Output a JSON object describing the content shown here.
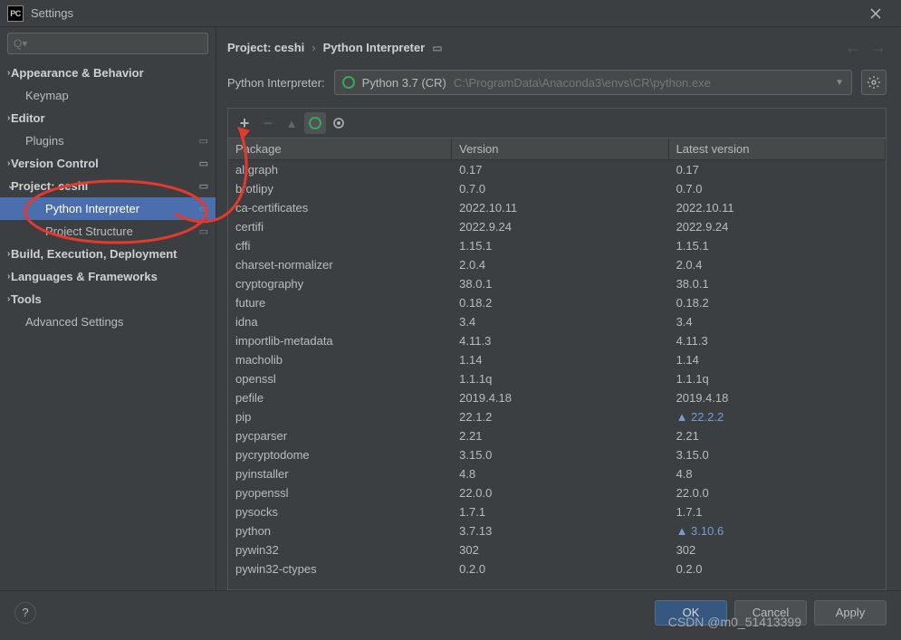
{
  "window": {
    "title": "Settings"
  },
  "search": {
    "placeholder": "Q▾"
  },
  "sidebar": {
    "items": [
      {
        "label": "Appearance & Behavior",
        "expandable": true
      },
      {
        "label": "Keymap"
      },
      {
        "label": "Editor",
        "expandable": true
      },
      {
        "label": "Plugins",
        "marker": "▭"
      },
      {
        "label": "Version Control",
        "expandable": true,
        "marker": "▭"
      },
      {
        "label": "Project: ceshi",
        "expandable": true,
        "expanded": true,
        "marker": "▭"
      },
      {
        "label": "Python Interpreter",
        "depth": 2,
        "selected": true,
        "marker": "▭"
      },
      {
        "label": "Project Structure",
        "depth": 2,
        "marker": "▭"
      },
      {
        "label": "Build, Execution, Deployment",
        "expandable": true
      },
      {
        "label": "Languages & Frameworks",
        "expandable": true
      },
      {
        "label": "Tools",
        "expandable": true
      },
      {
        "label": "Advanced Settings"
      }
    ]
  },
  "breadcrumb": {
    "project": "Project: ceshi",
    "page": "Python Interpreter"
  },
  "interpreter": {
    "label": "Python Interpreter:",
    "name": "Python 3.7 (CR)",
    "path": "C:\\ProgramData\\Anaconda3\\envs\\CR\\python.exe"
  },
  "table": {
    "headers": {
      "pkg": "Package",
      "ver": "Version",
      "latest": "Latest version"
    },
    "rows": [
      {
        "pkg": "altgraph",
        "ver": "0.17",
        "latest": "0.17"
      },
      {
        "pkg": "brotlipy",
        "ver": "0.7.0",
        "latest": "0.7.0"
      },
      {
        "pkg": "ca-certificates",
        "ver": "2022.10.11",
        "latest": "2022.10.11"
      },
      {
        "pkg": "certifi",
        "ver": "2022.9.24",
        "latest": "2022.9.24"
      },
      {
        "pkg": "cffi",
        "ver": "1.15.1",
        "latest": "1.15.1"
      },
      {
        "pkg": "charset-normalizer",
        "ver": "2.0.4",
        "latest": "2.0.4"
      },
      {
        "pkg": "cryptography",
        "ver": "38.0.1",
        "latest": "38.0.1"
      },
      {
        "pkg": "future",
        "ver": "0.18.2",
        "latest": "0.18.2"
      },
      {
        "pkg": "idna",
        "ver": "3.4",
        "latest": "3.4"
      },
      {
        "pkg": "importlib-metadata",
        "ver": "4.11.3",
        "latest": "4.11.3"
      },
      {
        "pkg": "macholib",
        "ver": "1.14",
        "latest": "1.14"
      },
      {
        "pkg": "openssl",
        "ver": "1.1.1q",
        "latest": "1.1.1q"
      },
      {
        "pkg": "pefile",
        "ver": "2019.4.18",
        "latest": "2019.4.18"
      },
      {
        "pkg": "pip",
        "ver": "22.1.2",
        "latest": "22.2.2",
        "upgrade": true
      },
      {
        "pkg": "pycparser",
        "ver": "2.21",
        "latest": "2.21"
      },
      {
        "pkg": "pycryptodome",
        "ver": "3.15.0",
        "latest": "3.15.0"
      },
      {
        "pkg": "pyinstaller",
        "ver": "4.8",
        "latest": "4.8"
      },
      {
        "pkg": "pyopenssl",
        "ver": "22.0.0",
        "latest": "22.0.0"
      },
      {
        "pkg": "pysocks",
        "ver": "1.7.1",
        "latest": "1.7.1"
      },
      {
        "pkg": "python",
        "ver": "3.7.13",
        "latest": "3.10.6",
        "upgrade": true
      },
      {
        "pkg": "pywin32",
        "ver": "302",
        "latest": "302"
      },
      {
        "pkg": "pywin32-ctypes",
        "ver": "0.2.0",
        "latest": "0.2.0"
      }
    ]
  },
  "footer": {
    "ok": "OK",
    "cancel": "Cancel",
    "apply": "Apply",
    "help": "?"
  },
  "watermark": "CSDN @m0_51413399"
}
